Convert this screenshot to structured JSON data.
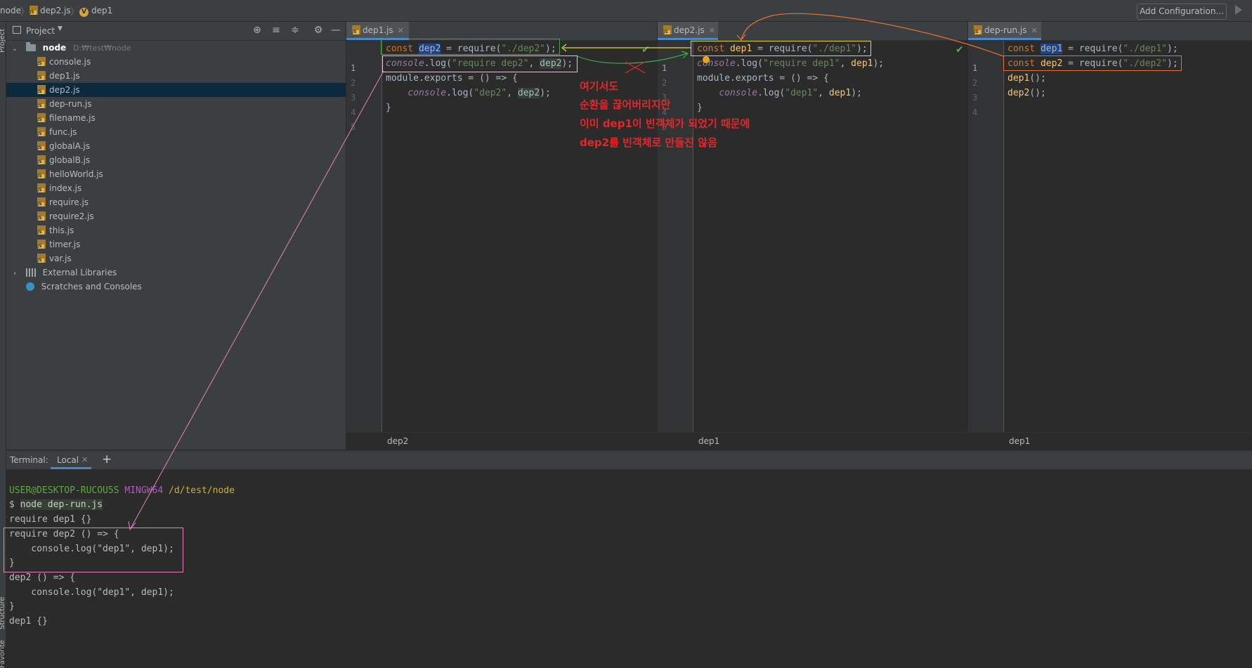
{
  "navbar": {
    "crumbs": [
      "node",
      "dep2.js",
      "dep1"
    ],
    "add_configuration": "Add Configuration...",
    "v_badge": "V"
  },
  "tool_stripe": {
    "top_label": "Project",
    "bottom_labels": [
      "Structure",
      "Favorites"
    ]
  },
  "project": {
    "title": "Project",
    "root_name": "node",
    "root_path": "D:₩test₩node",
    "files": [
      "console.js",
      "dep1.js",
      "dep2.js",
      "dep-run.js",
      "filename.js",
      "func.js",
      "globalA.js",
      "globalB.js",
      "helloWorld.js",
      "index.js",
      "require.js",
      "require2.js",
      "this.js",
      "timer.js",
      "var.js"
    ],
    "selected_file": "dep2.js",
    "external_libraries": "External Libraries",
    "scratches": "Scratches and Consoles"
  },
  "editors": [
    {
      "tab": "dep1.js",
      "lines": [
        "1",
        "2",
        "3",
        "4",
        "5"
      ],
      "status": "dep2"
    },
    {
      "tab": "dep2.js",
      "lines": [
        "1",
        "2",
        "3",
        "4",
        "5"
      ],
      "status": "dep1"
    },
    {
      "tab": "dep-run.js",
      "lines": [
        "1",
        "2",
        "3",
        "4"
      ],
      "status": "dep1"
    }
  ],
  "code": {
    "const": "const",
    "require": "require",
    "console": "console",
    "log": "log",
    "module": "module",
    "exports": "exports",
    "arrow": " = () => {",
    "close_brace": "}",
    "dep1": "dep1",
    "dep2": "dep2",
    "eq_require": " = ",
    "paren_open": "(",
    "paren_close": ");",
    "dot": ".",
    "str_dep1": "\"./dep1\"",
    "str_dep2": "\"./dep2\"",
    "str_require_dep1": "\"require dep1\"",
    "str_require_dep2": "\"require dep2\"",
    "str_log_dep1": "\"dep1\"",
    "str_log_dep2": "\"dep2\"",
    "comma": ", ",
    "indent": "    ",
    "call_tail": "();"
  },
  "terminal": {
    "label": "Terminal:",
    "tab": "Local",
    "prompt_user": "USER@DESKTOP-RUCOU5S",
    "prompt_env": "MINGW64",
    "prompt_path": "/d/test/node",
    "dollar": "$",
    "command": "node dep-run.js",
    "output": [
      "require dep1 {}",
      "require dep2 () => {",
      "    console.log(\"dep1\", dep1);",
      "}",
      "dep2 () => {",
      "    console.log(\"dep1\", dep1);",
      "}",
      "dep1 {}"
    ]
  },
  "annotation": {
    "lines": [
      "여기서도",
      "순환을 끊어버리지만",
      "이미 dep1이 빈객체가 되었기 때문에",
      "dep2를 빈객체로 만들진 않음"
    ],
    "colors": {
      "red": "#e3282b",
      "green": "#3fa84a",
      "yellow": "#e5d93a",
      "orange": "#e5722c",
      "pink": "#e77fc2",
      "white": "#d9d9d9"
    }
  }
}
